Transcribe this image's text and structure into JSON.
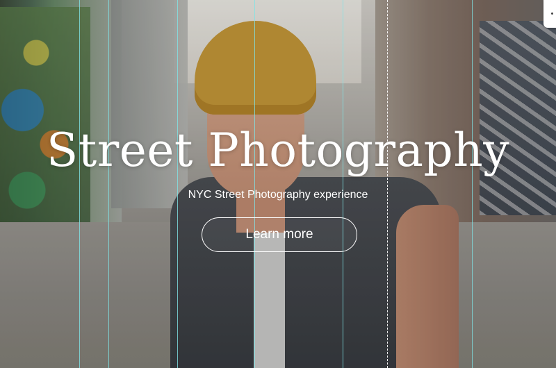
{
  "hero": {
    "headline": "Street Photography",
    "subline": "NYC Street Photography experience",
    "cta_label": "Learn more"
  },
  "colors": {
    "text": "#ffffff",
    "guide": "#7fe3e6",
    "beanie": "#c89a3a"
  },
  "icons": {
    "corner_tab": "side-panel-tab-icon"
  }
}
